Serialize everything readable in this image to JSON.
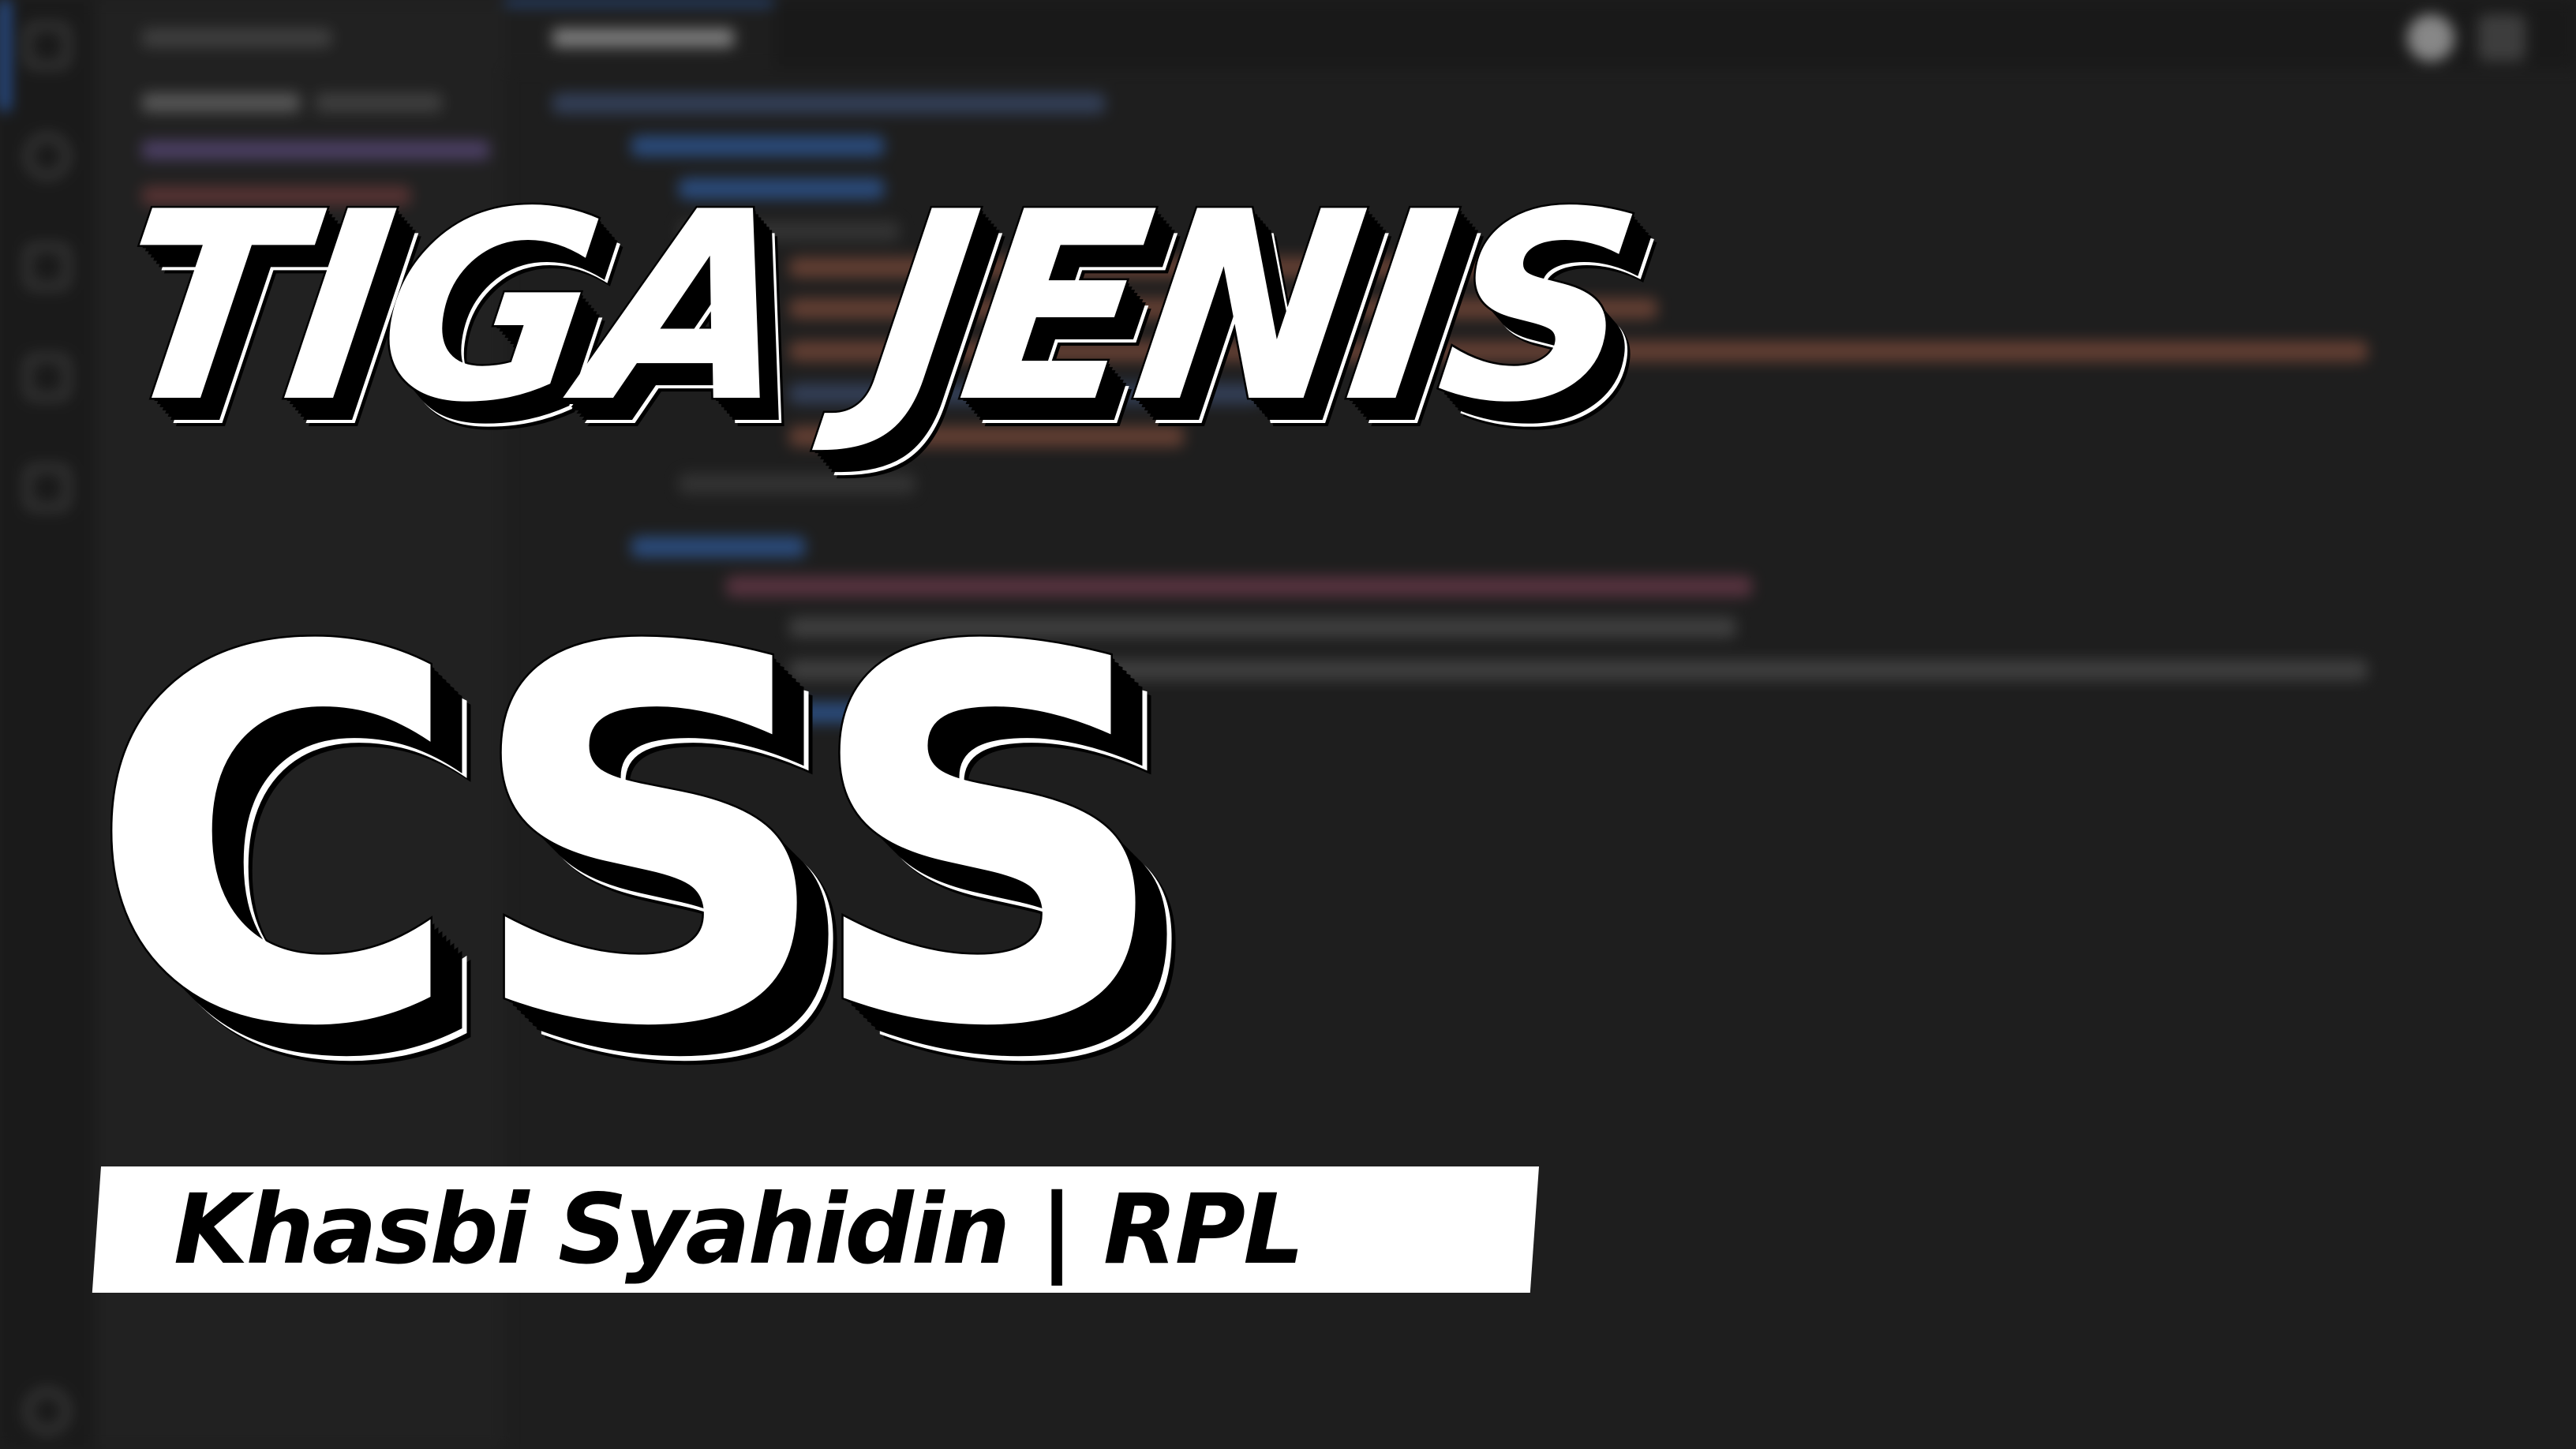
{
  "thumbnail": {
    "title_line_1": "TIGA JENIS",
    "title_line_2": "CSS",
    "author": "Khasbi Syahidin | RPL"
  },
  "colors": {
    "background": "#1e1e1e",
    "title_fill": "#ffffff",
    "title_outline": "#000000",
    "banner_fill": "#ffffff",
    "banner_text": "#000000",
    "editor_accent": "#2f6fd6"
  },
  "background_icons": [
    "explorer-icon",
    "search-icon",
    "run-debug-icon",
    "extensions-icon",
    "settings-gear-icon",
    "account-icon"
  ]
}
